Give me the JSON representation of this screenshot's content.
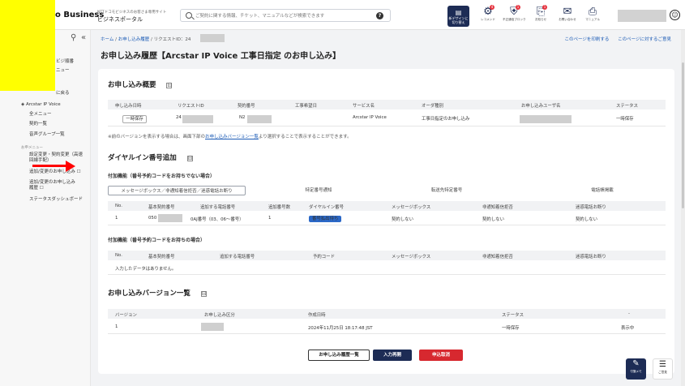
{
  "header": {
    "brand": "o Business",
    "portal_small": "NTTドコモビジネスのお客さま専用サイト",
    "portal_main": "ビジネスポータル",
    "search_placeholder": "ご契約に関する情報、チケット、マニュアルなどが検索できます",
    "help_icon": "?",
    "new_design_label": "新デザインに切り替え",
    "icons": [
      {
        "label": "レコメンド",
        "badge": "4"
      },
      {
        "label": "不正通信ブロック",
        "badge": "1"
      },
      {
        "label": "お知らせ",
        "badge": "1"
      },
      {
        "label": "お問い合わせ",
        "badge": ""
      },
      {
        "label": "マニュアル",
        "badge": ""
      }
    ]
  },
  "sidebar": {
    "items_top": [
      "ビジ順番",
      "ニュー"
    ],
    "back": "に戻る",
    "service": "Arcstar IP Voice",
    "menu": [
      "全メニュー",
      "契約一覧",
      "音声グループ一覧"
    ],
    "section": "お申メニュー",
    "links": [
      "設定変更・契約変更（高速回線手配）",
      "追加/変更のお申し込み ☐",
      "追加/変更のお申し込み履歴 ☐",
      "ステータスダッシュボード"
    ]
  },
  "breadcrumb": {
    "home": "ホーム",
    "history": "お申し込み履歴",
    "request": "リクエストID：24"
  },
  "toplinks": {
    "print": "このページを印刷する",
    "feedback": "このページに対するご意見"
  },
  "page_title": "お申し込み履歴【Arcstar IP Voice 工事日指定 のお申し込み】",
  "overview": {
    "title": "お申し込み概要",
    "collapse_icon": "⊟",
    "headers": [
      "申し込み日時",
      "リクエストID",
      "契約番号",
      "工事希望日",
      "サービス名",
      "オーダ種別",
      "お申し込みユーザ名",
      "ステータス"
    ],
    "row": {
      "date_badge": "一時保存",
      "request_id": "24",
      "contract": "N2",
      "service": "Arcstar IP Voice",
      "order": "工事日指定のお申し込み",
      "status": "一時保存"
    },
    "note_pre": "※前のバージョンを表示する場合は、画面下部の",
    "note_link": "お申し込みバージョン一覧",
    "note_post": "より選択することで表示することができます。"
  },
  "dial": {
    "title": "ダイヤルイン番号追加",
    "collapse_icon": "⊟",
    "sub1": "付加機能（番号予約コードをお持ちでない場合）",
    "tabs": [
      "メッセージボックス／非通知着信拒否／迷惑電話お断り",
      "特定番号通知",
      "転送先特定番号",
      "電話帳掲載"
    ],
    "headers1": [
      "No.",
      "基本契約番号",
      "追加する電話番号",
      "追加番号数",
      "ダイヤルイン番号",
      "メッセージボックス",
      "非通知着信拒否",
      "迷惑電話お断り"
    ],
    "row1": {
      "no": "1",
      "basic": "050",
      "phone": "0AJ番号（03、06～番号）",
      "count": "1",
      "dialin": "番号払出待ち",
      "msgbox": "契約しない",
      "reject": "契約しない",
      "spam": "契約しない"
    },
    "sub2": "付加機能（番号予約コードをお持ちの場合）",
    "headers2": [
      "No.",
      "基本契約番号",
      "追加する電話番号",
      "予約コード",
      "メッセージボックス",
      "非通知着信拒否",
      "迷惑電話お断り"
    ],
    "empty": "入力したデータはありません。"
  },
  "versions": {
    "title": "お申し込みバージョン一覧",
    "collapse_icon": "⊟",
    "headers": [
      "バージョン",
      "お申し込み区分",
      "作成日時",
      "ステータス",
      "-"
    ],
    "row": {
      "version": "1",
      "date": "2024年11月25日 18:17:48 JST",
      "status": "一時保存",
      "view": "表示中"
    }
  },
  "buttons": {
    "back": "お申し込み履歴一覧",
    "reenter": "入力再開",
    "cancel": "申込取消"
  },
  "floats": [
    "付箋メモ",
    "ご意見"
  ]
}
